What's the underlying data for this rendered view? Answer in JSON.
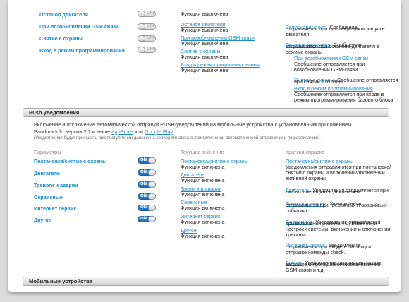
{
  "top_rows": [
    {
      "label": "Останов двигателя",
      "toggle": "OFF"
    },
    {
      "label": "При возобновлении GSM связи",
      "toggle": "OFF"
    },
    {
      "label": "Снятие с охраны",
      "toggle": "OFF"
    },
    {
      "label": "Вход в режим программирования",
      "toggle": "OFF"
    }
  ],
  "top_current": [
    {
      "name": "",
      "status": "Функция выключена"
    },
    {
      "name": "Останов двигателя",
      "status": "Функция выключена"
    },
    {
      "name": "При возобновлении GSM связи",
      "status": "Функция выключена"
    },
    {
      "name": "Снятие с охраны",
      "status": "Функция выключена"
    },
    {
      "name": "Вход в режим программирования",
      "status": "Функция выключена"
    }
  ],
  "top_help": [
    {
      "name": "Запуск двигателя",
      "lines": [
        "Сообщение",
        "отправляется при дистанционном запуске",
        "двигателя"
      ]
    },
    {
      "name": "Останов двигателя",
      "lines": [
        "Сообщение",
        "отправляется при останове двигателя в",
        "режиме охраны"
      ]
    },
    {
      "name": "При возобновлении GSM связи",
      "lines": [
        "Сообщение отправляется при",
        "возобновлении GSM-связи"
      ]
    },
    {
      "name": "Снятие с охраны",
      "lines": [
        "Сообщение отправляется",
        "при снятии с охраны"
      ]
    },
    {
      "name": "Вход в режим программирования",
      "lines": [
        "Сообщение отправляется при входе в",
        "режим программирования базового блока"
      ]
    }
  ],
  "push": {
    "title": "Push уведомления",
    "desc_line1": "Включение и отключение автоматической отправки PUSH-уведомлений на мобильные устройства с установленным приложением",
    "desc_line2_prefix": "Pandora Info версии 2.1 и выше ",
    "appstore_link": "appStore",
    "or_text": " или ",
    "googleplay_link": "Google Play",
    "desc_line2_suffix": ".",
    "note": "(Уведомления будут приходить при поступлении данных на сервер мгновенно при включении автоматической отправки или по расписанию).",
    "col_params": "Параметры",
    "col_current": "Текущее значение",
    "col_help": "Краткая справка",
    "rows": [
      {
        "label": "Постановка/снятие с охраны",
        "toggle": "ON"
      },
      {
        "label": "Двигатель",
        "toggle": "ON"
      },
      {
        "label": "Тревоги и аварии",
        "toggle": "ON"
      },
      {
        "label": "Сервисные",
        "toggle": "ON"
      },
      {
        "label": "Интернет сервис",
        "toggle": "ON"
      },
      {
        "label": "Другое",
        "toggle": "ON"
      }
    ],
    "current": [
      {
        "name": "Постановка/снятие с охраны",
        "status": "Функция включена"
      },
      {
        "name": "Двигатель",
        "status": "Функция включена"
      },
      {
        "name": "Тревоги и аварии",
        "status": "Функция включена"
      },
      {
        "name": "Сервисные",
        "status": "Функция включена"
      },
      {
        "name": "Интернет сервис",
        "status": "Функция включена"
      },
      {
        "name": "Другое",
        "status": "Функция включена"
      }
    ],
    "help": [
      {
        "name": "Постановка/снятие с охраны",
        "lines": [
          "Уведомления отправляются при постановке/",
          "снятии с охраны и включении/отключении",
          "активной охраны"
        ]
      },
      {
        "name": "Двигатель",
        "lines": [
          "Уведомления отправляются при",
          "любых операциях с двигателем."
        ]
      },
      {
        "name": "Тревоги и аварии",
        "lines": [
          "Уведомления",
          "отправляются при тревожных и аварийных",
          "событиях"
        ]
      },
      {
        "name": "Сервисные",
        "lines": [
          "Уведомление отправляется",
          "при включении режима ТО, изменении",
          "настроек системы, включении и отключении",
          "трекинга."
        ]
      },
      {
        "name": "Интернет сервис",
        "lines": [
          "Уведомление",
          "отправляется при входе в систему и",
          "отправке команды check."
        ]
      },
      {
        "name": "Другое",
        "lines": [
          "Уведомление отправляются при",
          "заправке и пропадании/восстановлении",
          "GSM связи и т.д."
        ]
      }
    ]
  },
  "mobile": {
    "title": "Мобильные устройства"
  }
}
